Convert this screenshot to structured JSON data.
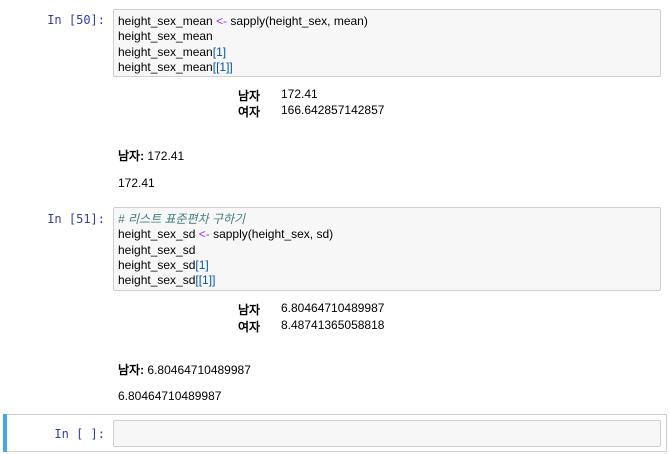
{
  "cells": [
    {
      "prompt": "In [50]:",
      "code": {
        "l1_a": "height_sex_mean ",
        "l1_op": "<-",
        "l1_b": " sapply(height_sex, mean)",
        "l2": "height_sex_mean",
        "l3_a": "height_sex_mean",
        "l3_b": "[1]",
        "l4_a": "height_sex_mean",
        "l4_b": "[[1]]"
      },
      "output_table": [
        {
          "label": "남자",
          "value": "172.41"
        },
        {
          "label": "여자",
          "value": "166.642857142857"
        }
      ],
      "output_named": {
        "label": "남자:",
        "value": "172.41"
      },
      "output_plain": "172.41"
    },
    {
      "prompt": "In [51]:",
      "code": {
        "comment": "# 리스트 표준편차 구하기",
        "l1_a": "height_sex_sd ",
        "l1_op": "<-",
        "l1_b": " sapply(height_sex, sd)",
        "l2": "height_sex_sd",
        "l3_a": "height_sex_sd",
        "l3_b": "[1]",
        "l4_a": "height_sex_sd",
        "l4_b": "[[1]]"
      },
      "output_table": [
        {
          "label": "남자",
          "value": "6.80464710489987"
        },
        {
          "label": "여자",
          "value": "8.48741365058818"
        }
      ],
      "output_named": {
        "label": "남자:",
        "value": "6.80464710489987"
      },
      "output_plain": "6.80464710489987"
    },
    {
      "prompt": "In [ ]:",
      "code": ""
    }
  ],
  "colors": {
    "prompt": "#303f9f",
    "selection": "#42a5f5",
    "operator": "#aa22ff",
    "comment": "#408080"
  }
}
